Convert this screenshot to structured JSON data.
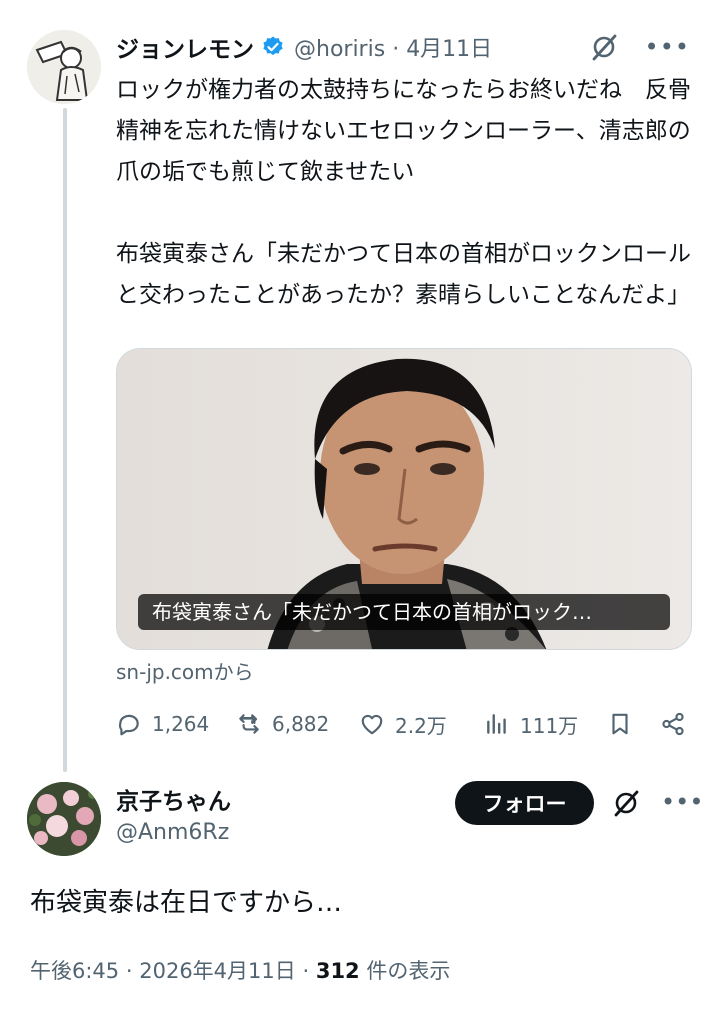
{
  "tweet": {
    "author_name": "ジョンレモン",
    "handle": "@horiris",
    "separator": "·",
    "date": "4月11日",
    "paragraphs": [
      "ロックが権力者の太鼓持ちになったらお終いだね　反骨精神を忘れた情けないエセロックンローラー、清志郎の爪の垢でも煎じて飲ませたい",
      "布袋寅泰さん「未だかつて日本の首相がロックンロールと交わったことがあったか？素晴らしいことなんだよ」"
    ],
    "card": {
      "caption": "布袋寅泰さん「未だかつて日本の首相がロック…",
      "source": "sn-jp.comから"
    },
    "stats": {
      "replies": "1,264",
      "retweets": "6,882",
      "likes": "2.2万",
      "views": "111万"
    },
    "icons": [
      "verified-badge-icon",
      "grok-icon",
      "more-icon",
      "reply-icon",
      "retweet-icon",
      "like-icon",
      "views-icon",
      "bookmark-icon",
      "share-icon"
    ],
    "colors": {
      "verified": "#1d9bf0",
      "secondary_text": "#536471",
      "primary_text": "#0f1419"
    }
  },
  "reply": {
    "author_name": "京子ちゃん",
    "handle": "@Anm6Rz",
    "follow_label": "フォロー",
    "text": "布袋寅泰は在日ですから…",
    "time": "午後6:45",
    "sep1": "·",
    "date": "2026年4月11日",
    "sep2": "·",
    "views_count": "312",
    "views_suffix": "件の表示"
  }
}
